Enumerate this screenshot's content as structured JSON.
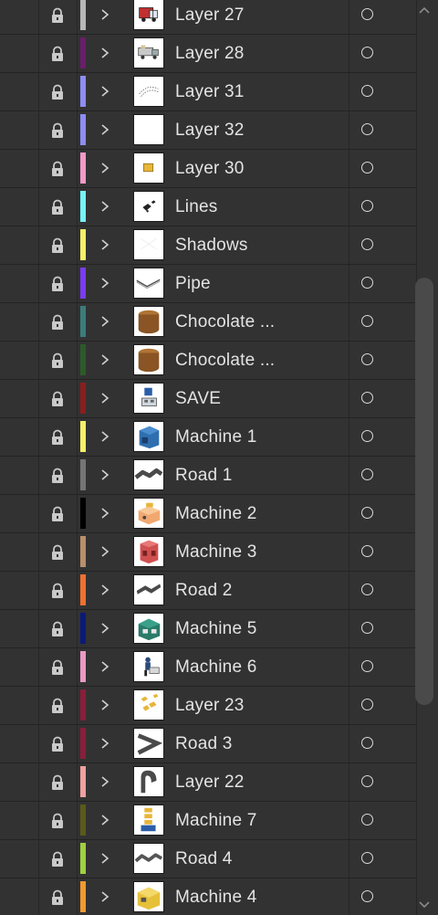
{
  "layers": [
    {
      "name": "Layer 27",
      "color": "#b8b8b8",
      "thumb": "truck-red"
    },
    {
      "name": "Layer 28",
      "color": "#6b1d6b",
      "thumb": "truck-gray"
    },
    {
      "name": "Layer 31",
      "color": "#8d8df5",
      "thumb": "sketch-lines"
    },
    {
      "name": "Layer 32",
      "color": "#8d8df5",
      "thumb": "blank"
    },
    {
      "name": "Layer 30",
      "color": "#f09ac8",
      "thumb": "small-box"
    },
    {
      "name": "Lines",
      "color": "#76f3f6",
      "thumb": "dark-marks"
    },
    {
      "name": "Shadows",
      "color": "#f5f06a",
      "thumb": "faint"
    },
    {
      "name": "Pipe",
      "color": "#7a3cf0",
      "thumb": "pipe"
    },
    {
      "name": "Chocolate ...",
      "color": "#3c7c7c",
      "thumb": "chocolate"
    },
    {
      "name": "Chocolate ...",
      "color": "#2c5a28",
      "thumb": "chocolate"
    },
    {
      "name": "SAVE",
      "color": "#8a1e1e",
      "thumb": "save-machine"
    },
    {
      "name": "Machine 1",
      "color": "#f5f06a",
      "thumb": "machine-blue"
    },
    {
      "name": "Road 1",
      "color": "#757575",
      "thumb": "road-wave"
    },
    {
      "name": "Machine 2",
      "color": "#000000",
      "thumb": "machine-orange"
    },
    {
      "name": "Machine 3",
      "color": "#b9906a",
      "thumb": "machine-red"
    },
    {
      "name": "Road 2",
      "color": "#f07030",
      "thumb": "road-step"
    },
    {
      "name": "Machine 5",
      "color": "#0a1a7a",
      "thumb": "machine-teal"
    },
    {
      "name": "Machine 6",
      "color": "#e89ac4",
      "thumb": "worker"
    },
    {
      "name": "Layer 23",
      "color": "#8a1e3a",
      "thumb": "yellow-pieces"
    },
    {
      "name": "Road 3",
      "color": "#8a1e3a",
      "thumb": "road-chevron"
    },
    {
      "name": "Layer 22",
      "color": "#f0a0a0",
      "thumb": "road-arch"
    },
    {
      "name": "Machine 7",
      "color": "#5a5a1a",
      "thumb": "machine-stack"
    },
    {
      "name": "Road 4",
      "color": "#a0d040",
      "thumb": "road-zigzag"
    },
    {
      "name": "Machine 4",
      "color": "#f09a30",
      "thumb": "machine-yellow"
    }
  ]
}
